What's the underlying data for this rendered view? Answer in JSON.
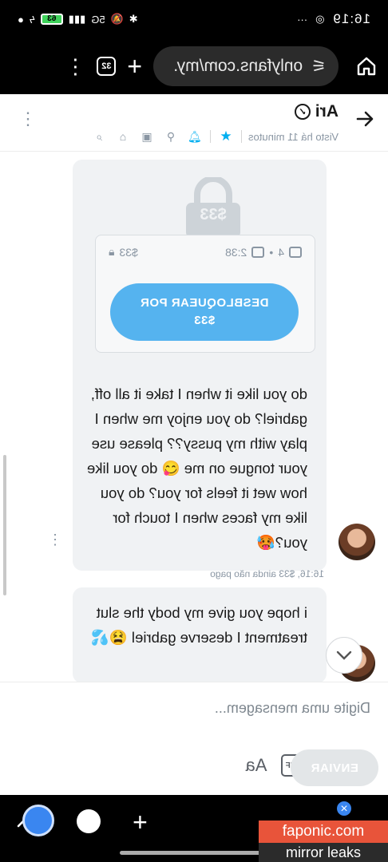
{
  "status_bar": {
    "time": "16:19",
    "battery_label": "63",
    "network_label": "5G"
  },
  "browser": {
    "url": "onlyfans.com/my.",
    "tab_count": "32"
  },
  "chat_header": {
    "name": "Ari",
    "last_seen": "Visto há 11 minutos"
  },
  "locked_message": {
    "price_badge": "$33",
    "media_count": "4",
    "duration": "2:38",
    "lock_price": "$33",
    "unlock_line1": "DESBLOQUEAR POR",
    "unlock_line2": "$33",
    "text": "do you like it when I take it all off, gabriel? do you enjoy me when I play with my pussy?? please use your tongue on me 😋 do you like how wet it feels for you? do you like my faces when I touch for you?🥵",
    "timestamp": "16:16, $33 ainda não pago"
  },
  "second_message": {
    "text": "i hope you give my body the slut treatment I deserve gabriel 😫💦"
  },
  "composer": {
    "placeholder": "Digite uma mensagem...",
    "send_label": "ENVIAR",
    "gif_label": "GIF",
    "aa_label": "Aa"
  },
  "watermark": {
    "line1": "faponic.com",
    "line2": "mirror leaks"
  },
  "colors": {
    "accent": "#00aff0",
    "unlock_button": "#55b3ef",
    "bubble": "#f0f2f4"
  }
}
